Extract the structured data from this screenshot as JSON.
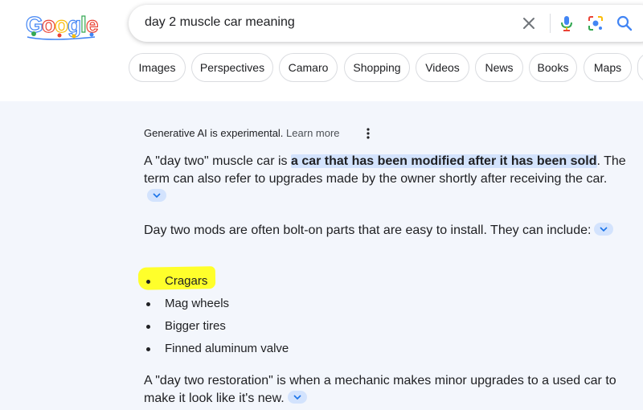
{
  "header": {
    "logo_text": "Google",
    "search_query": "day 2 muscle car meaning",
    "icons": [
      "clear-icon",
      "microphone-icon",
      "lens-icon",
      "search-icon"
    ]
  },
  "chips": [
    "Images",
    "Perspectives",
    "Camaro",
    "Shopping",
    "Videos",
    "News",
    "Books",
    "Maps"
  ],
  "ai_overview": {
    "disclaimer": "Generative AI is experimental.",
    "learn_more": "Learn more",
    "p1_before": "A \"day two\" muscle car is ",
    "p1_highlight": "a car that has been modified after it has been sold",
    "p1_after": ". The term can also refer to upgrades made by the owner shortly after receiving the car.",
    "p2": "Day two mods are often bolt-on parts that are easy to install. They can include:",
    "bullets": [
      "Cragars",
      "Mag wheels",
      "Bigger tires",
      "Finned aluminum valve"
    ],
    "p3": "A \"day two restoration\" is when a mechanic makes minor upgrades to a used car to make it look like it's new."
  },
  "colors": {
    "ai_panel_bg": "#f3f6fc",
    "highlight_bg": "#d3e3fd",
    "marker_yellow": "#ffff2b"
  }
}
